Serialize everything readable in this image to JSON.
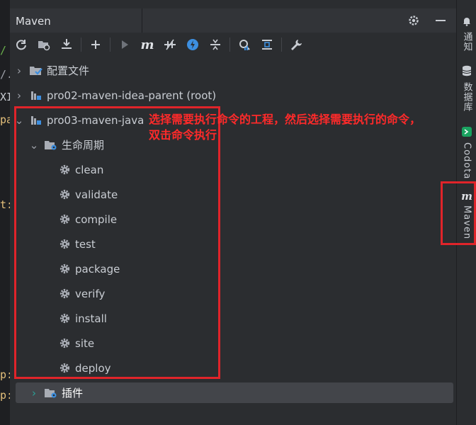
{
  "panel": {
    "title": "Maven"
  },
  "toolbar": {
    "icons": [
      "reload-icon",
      "reimport-folder-icon",
      "download-icon",
      "add-icon",
      "run-icon",
      "maven-m-icon",
      "toggle-offline-icon",
      "skip-tests-icon",
      "collapse-icon",
      "analyze-dependencies-icon",
      "show-diagram-icon",
      "wrench-icon"
    ]
  },
  "tree": {
    "config_files": "配置文件",
    "project_parent": "pro02-maven-idea-parent (root)",
    "project_java": "pro03-maven-java",
    "lifecycle": "生命周期",
    "goals": [
      "clean",
      "validate",
      "compile",
      "test",
      "package",
      "verify",
      "install",
      "site",
      "deploy"
    ],
    "plugins": "插件"
  },
  "annotation": {
    "line1": "选择需要执行命令的工程，然后选择需要执行的命令，",
    "line2": "双击命令执行"
  },
  "right_tabs": {
    "notifications": "通知",
    "database": "数据库",
    "codota": "Codota",
    "maven": "Maven"
  },
  "editor_fragments": [
    "/",
    "/.",
    "XI",
    "pa",
    "t:",
    "p:",
    "p:"
  ],
  "colors": {
    "annotation_red": "#ff2a2a",
    "panel_bg": "#2b2d30",
    "selected_row": "#43454a",
    "accent_blue": "#3d8fe0"
  }
}
